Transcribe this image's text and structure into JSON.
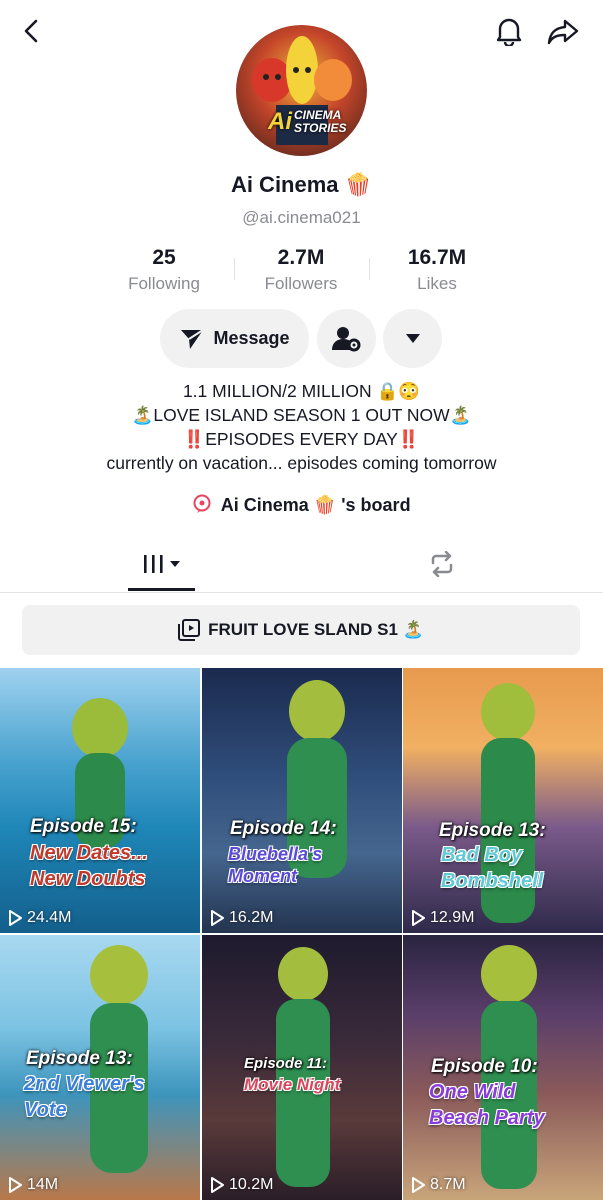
{
  "header": {
    "back": "back-icon",
    "bell": "bell-icon",
    "share": "share-icon"
  },
  "profile": {
    "name": "Ai Cinema",
    "name_emoji": "🍿",
    "handle": "@ai.cinema021",
    "avatar_text_1": "Ai",
    "avatar_text_2": "CINEMA",
    "avatar_text_3": "STORIES"
  },
  "stats": [
    {
      "value": "25",
      "label": "Following"
    },
    {
      "value": "2.7M",
      "label": "Followers"
    },
    {
      "value": "16.7M",
      "label": "Likes"
    }
  ],
  "actions": {
    "message_label": "Message"
  },
  "bio": {
    "line1": "1.1 MILLION/2 MILLION 🔒😳",
    "line2": "🏝️LOVE ISLAND SEASON 1 OUT NOW🏝️",
    "line3": "‼️EPISODES EVERY DAY‼️",
    "line4": "currently on vacation... episodes coming tomorrow"
  },
  "board": {
    "name": "Ai Cinema",
    "emoji": "🍿",
    "suffix": "'s board"
  },
  "playlist": {
    "label": "FRUIT LOVE SLAND S1 🏝️"
  },
  "videos": [
    {
      "episode": "Episode 15:",
      "title1": "New Dates...",
      "title2": "New Doubts",
      "views": "24.4M",
      "color": "#c0392b"
    },
    {
      "episode": "Episode 14:",
      "title1": "Bluebella's",
      "title2": "Moment",
      "views": "16.2M",
      "color": "#5b4ad8"
    },
    {
      "episode": "Episode 13:",
      "title1": "Bad Boy",
      "title2": "Bombshell",
      "views": "12.9M",
      "color": "#5fc9d6"
    },
    {
      "episode": "Episode 13:",
      "title1": "2nd Viewer's",
      "title2": "Vote",
      "views": "14M",
      "color": "#3b7fd9"
    },
    {
      "episode": "Episode 11:",
      "title1": "Movie Night",
      "title2": "",
      "views": "10.2M",
      "color": "#d9475e"
    },
    {
      "episode": "Episode 10:",
      "title1": "One Wild",
      "title2": "Beach Party",
      "views": "8.7M",
      "color": "#8a3cd9"
    }
  ]
}
